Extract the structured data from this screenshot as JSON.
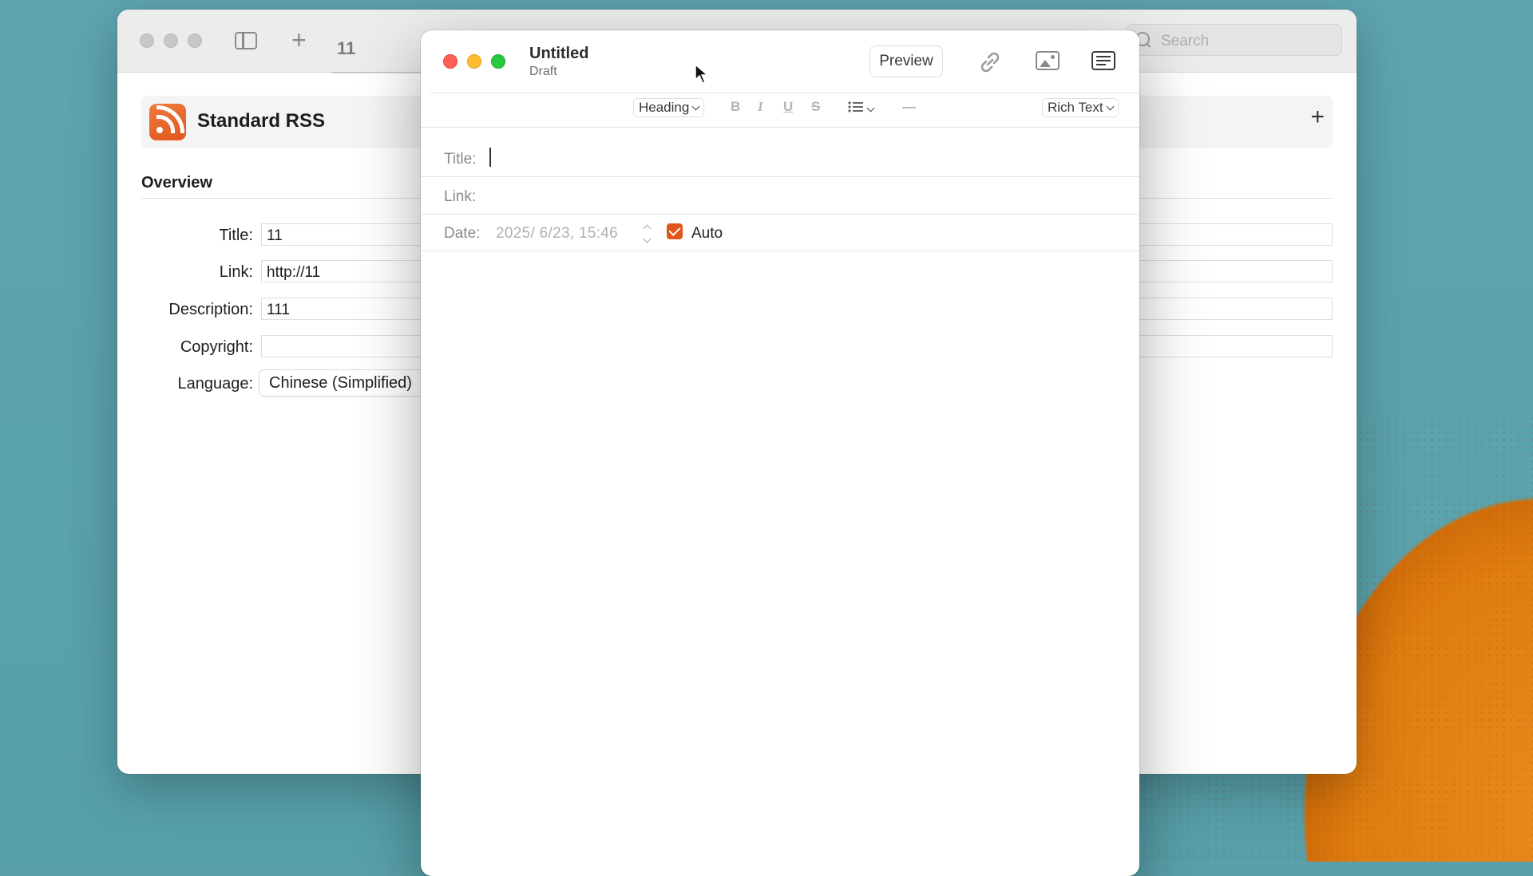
{
  "back_window": {
    "count": "11",
    "search_placeholder": "Search",
    "feed_title": "Standard RSS",
    "overview_heading": "Overview",
    "fields": [
      {
        "label": "Title:",
        "value": "11"
      },
      {
        "label": "Link:",
        "value": "http://11"
      },
      {
        "label": "Description:",
        "value": "111"
      },
      {
        "label": "Copyright:",
        "value": ""
      },
      {
        "label": "Language:",
        "value": "Chinese (Simplified)"
      }
    ],
    "add_symbol": "+",
    "new_symbol": "+"
  },
  "editor": {
    "title": "Untitled",
    "subtitle": "Draft",
    "preview_label": "Preview",
    "format_bar": {
      "heading": "Heading",
      "bold": "B",
      "italic": "I",
      "underline": "U",
      "strike": "S",
      "rule": "—",
      "mode": "Rich Text"
    },
    "title_label": "Title:",
    "link_label": "Link:",
    "date_label": "Date:",
    "date_value": "2025/  6/23, 15:46",
    "auto_label": "Auto",
    "auto_checked": true
  },
  "colors": {
    "accent": "#e0561e",
    "close": "#ff5f57",
    "minimize": "#febc2e",
    "zoom": "#28c840"
  }
}
